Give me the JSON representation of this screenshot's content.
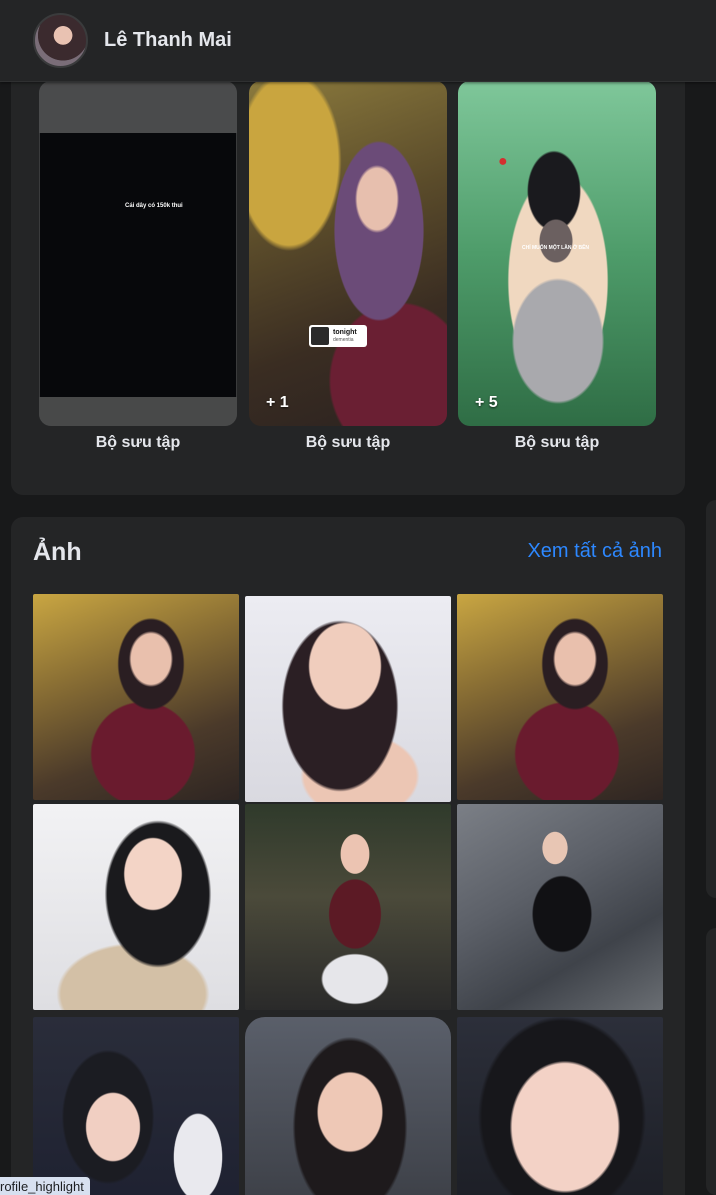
{
  "header": {
    "name": "Lê Thanh Mai"
  },
  "collections": [
    {
      "label": "Bộ sưu tập",
      "count": "",
      "preview_text": "Cái dây có 150k thui"
    },
    {
      "label": "Bộ sưu tập",
      "count": "+ 1",
      "sticker_title": "tonight",
      "sticker_sub": "dementia"
    },
    {
      "label": "Bộ sưu tập",
      "count": "+ 5",
      "preview_text": "CHỈ MUỐN MỘT LẦN Ở BÊN"
    }
  ],
  "photos_section": {
    "title": "Ảnh",
    "see_all": "Xem tất cả ảnh"
  },
  "tooltip": "rofile_highlight",
  "colors": {
    "background": "#18191a",
    "card": "#242526",
    "link": "#2d88ff",
    "text": "#e4e6eb"
  }
}
